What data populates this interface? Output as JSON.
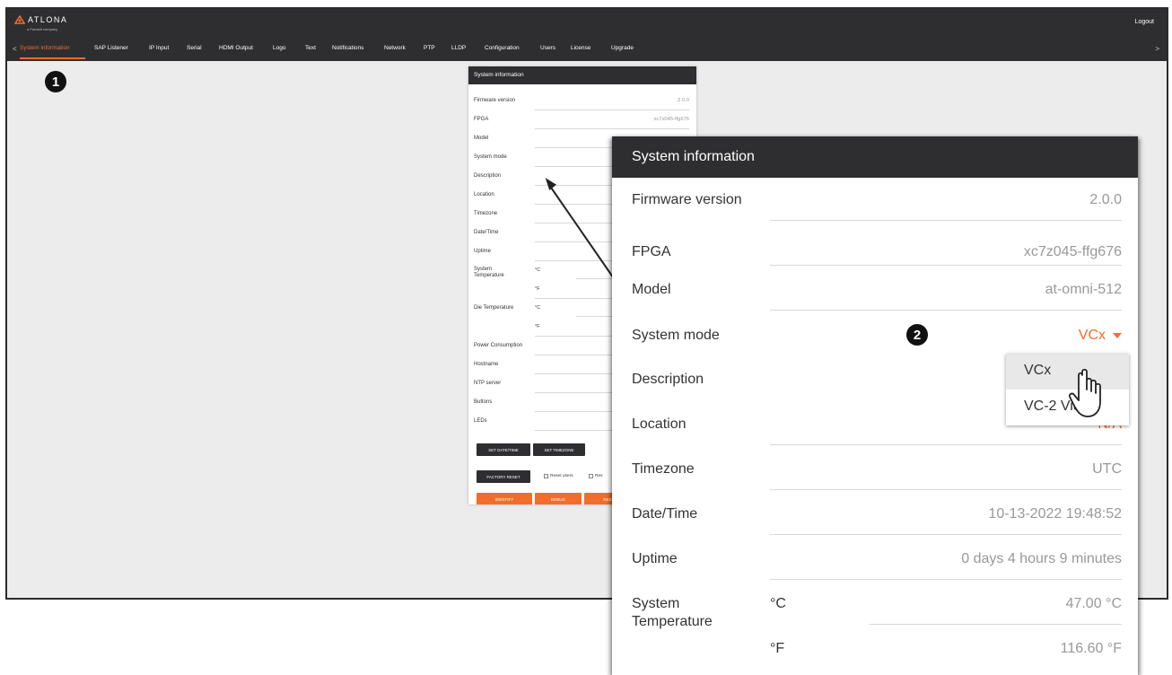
{
  "app": {
    "logo_text": "ATLONA",
    "logo_sub": "a Panduit company",
    "logout": "Logout",
    "nav_prev": "<",
    "nav_next": ">",
    "tabs": [
      "System information",
      "SAP Listener",
      "IP Input",
      "Serial",
      "HDMI Output",
      "Logo",
      "Text",
      "Notifications",
      "Network",
      "PTP",
      "LLDP",
      "Configuration",
      "Users",
      "License",
      "Upgrade"
    ],
    "active_tab": "System information"
  },
  "callouts": {
    "one": "1",
    "two": "2"
  },
  "small_panel": {
    "title": "System information",
    "rows": [
      {
        "label": "Firmware version",
        "value": "2.0.0"
      },
      {
        "label": "FPGA",
        "value": "xc7z045-ffg676"
      },
      {
        "label": "Model",
        "value": ""
      },
      {
        "label": "System mode",
        "value": ""
      },
      {
        "label": "Description",
        "value": ""
      },
      {
        "label": "Location",
        "value": ""
      },
      {
        "label": "Timezone",
        "value": ""
      },
      {
        "label": "Date/Time",
        "value": ""
      },
      {
        "label": "Uptime",
        "value": ""
      }
    ],
    "sys_temp_label": "System Temperature",
    "die_temp_label": "Die Temperature",
    "unit_c": "°C",
    "unit_f": "°F",
    "rows2": [
      {
        "label": "Power Consumption"
      },
      {
        "label": "Hostname"
      },
      {
        "label": "NTP server"
      },
      {
        "label": "Buttons"
      },
      {
        "label": "LEDs"
      }
    ],
    "buttons": {
      "set_datetime": "SET DATE/TIME",
      "set_timezone": "SET TIMEZONE",
      "factory_reset": "FACTORY RESET",
      "reset_users": "Reset users",
      "reset_other": "Res",
      "identify": "IDENTIFY",
      "debug": "DEBUG",
      "reboot": "REB"
    }
  },
  "zoom_panel": {
    "title": "System information",
    "rows": [
      {
        "label": "Firmware version",
        "value": "2.0.0"
      },
      {
        "label": "FPGA",
        "value": "xc7z045-ffg676"
      },
      {
        "label": "Model",
        "value": "at-omni-512"
      },
      {
        "label": "System mode",
        "value": "VCx"
      },
      {
        "label": "Description",
        "value": ""
      },
      {
        "label": "Location",
        "value": "N/A"
      },
      {
        "label": "Timezone",
        "value": "UTC"
      },
      {
        "label": "Date/Time",
        "value": "10-13-2022 19:48:52"
      },
      {
        "label": "Uptime",
        "value": "0 days 4 hours 9 minutes"
      }
    ],
    "sys_temp_label": "System Temperature",
    "unit_c": "°C",
    "unit_f": "°F",
    "temp_c": "47.00 °C",
    "temp_f": "116.60 °F"
  },
  "dropdown": {
    "options": [
      "VCx",
      "VC-2 Video"
    ],
    "selected": "VCx"
  },
  "colors": {
    "accent": "#f26d2c",
    "header": "#2e2e30"
  }
}
